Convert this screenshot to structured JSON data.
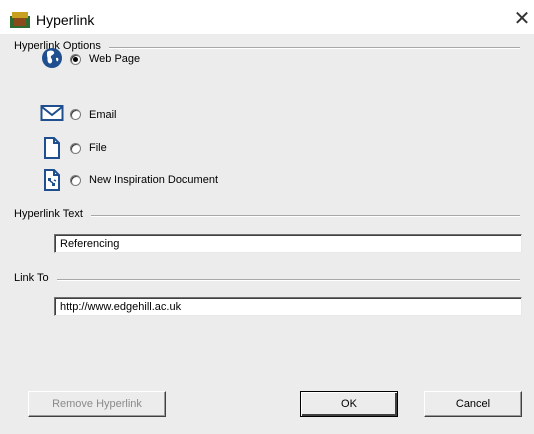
{
  "window": {
    "title": "Hyperlink",
    "close_glyph": "✕"
  },
  "options_group": {
    "label": "Hyperlink Options",
    "items": [
      {
        "label": "Web Page",
        "icon": "globe-icon",
        "checked": true
      },
      {
        "label": "Email",
        "icon": "envelope-icon",
        "checked": false
      },
      {
        "label": "File",
        "icon": "file-icon",
        "checked": false
      },
      {
        "label": "New Inspiration Document",
        "icon": "inspiration-document-icon",
        "checked": false
      }
    ]
  },
  "text_group": {
    "label": "Hyperlink Text",
    "value": "Referencing"
  },
  "link_group": {
    "label": "Link To",
    "value": "http://www.edgehill.ac.uk"
  },
  "buttons": {
    "remove": "Remove Hyperlink",
    "ok": "OK",
    "cancel": "Cancel"
  },
  "colors": {
    "icon_blue": "#1f4f8f",
    "dialog_background": "#ececec"
  }
}
